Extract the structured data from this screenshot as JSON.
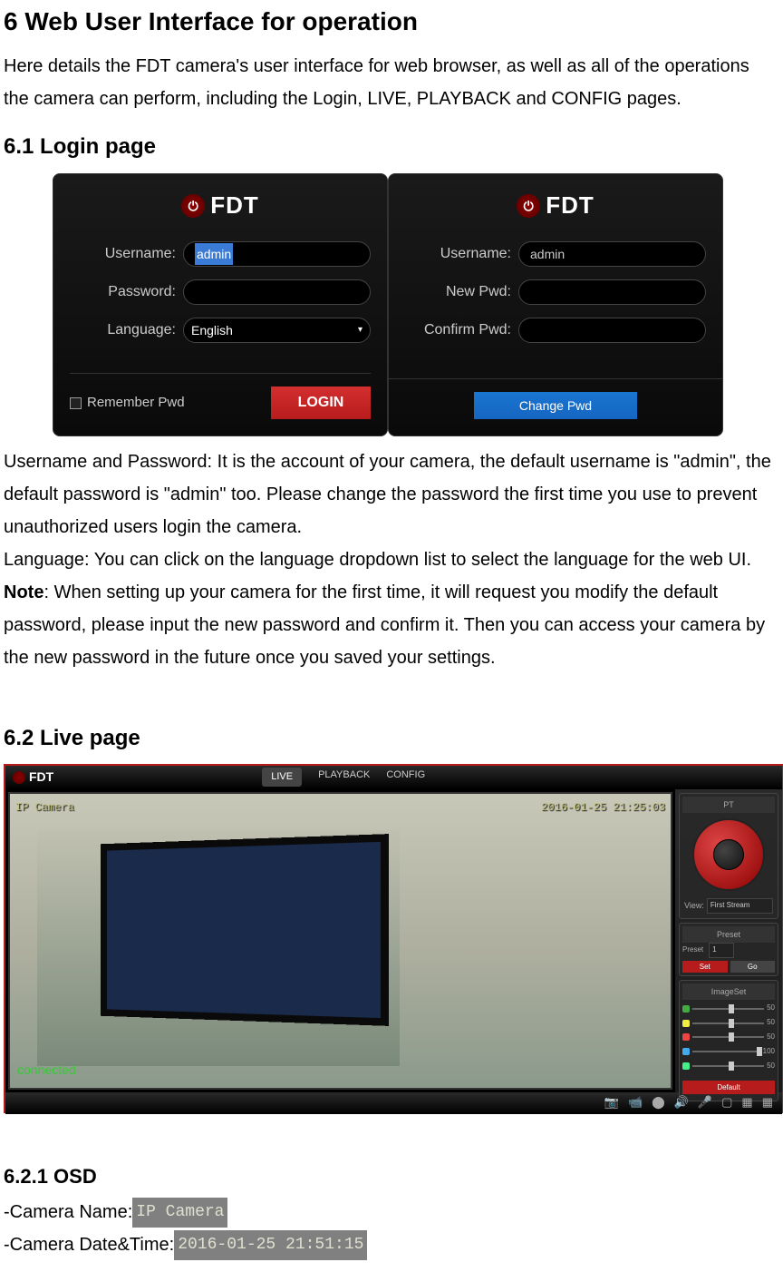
{
  "heading1": "6 Web User Interface for operation",
  "intro_text": "Here details the FDT camera's user interface for web browser, as well as all of the operations the camera can perform, including the Login, LIVE, PLAYBACK and CONFIG pages.",
  "heading2": "6.1 Login page",
  "login_panel": {
    "logo_text": "FDT",
    "logo_icon": "⏻",
    "username_label": "Username:",
    "username_value": "admin",
    "password_label": "Password:",
    "password_value": "",
    "language_label": "Language:",
    "language_value": "English",
    "remember_label": "Remember Pwd",
    "login_btn": "LOGIN"
  },
  "change_panel": {
    "logo_text": "FDT",
    "logo_icon": "⏻",
    "username_label": "Username:",
    "username_value": "admin",
    "newpwd_label": "New Pwd:",
    "newpwd_value": "",
    "confirm_label": "Confirm Pwd:",
    "confirm_value": "",
    "change_btn": "Change Pwd"
  },
  "p1": "Username and Password: It is the account of your camera, the default username is \"admin\", the default password is \"admin\" too. Please change the password the first time you use to prevent unauthorized users login the camera.",
  "p2": "Language: You can click on the language dropdown list to select the language for the web UI.",
  "note_label": "Note",
  "note_text": ": When setting up your camera for the first time, it will request you modify the default password, please input the new password and confirm it. Then you can access your camera by the new password in the future once you saved your settings.",
  "heading3": "6.2 Live page",
  "live_page": {
    "logo_text": "FDT",
    "tabs": [
      "LIVE",
      "PLAYBACK",
      "CONFIG"
    ],
    "osd_name": "IP Camera",
    "osd_time": "2016-01-25 21:25:03",
    "connected": "connected",
    "pt_label": "PT",
    "view_label": "View:",
    "view_value": "First Stream",
    "preset_label": "Preset",
    "preset_row_label": "Preset",
    "preset_value": "1",
    "set_btn": "Set",
    "go_btn": "Go",
    "imageset_label": "ImageSet",
    "default_btn": "Default",
    "sliders": [
      {
        "color": "#4a4",
        "value": "50"
      },
      {
        "color": "#ee4",
        "value": "50"
      },
      {
        "color": "#e44",
        "value": "50"
      },
      {
        "color": "#4ae",
        "value": "100"
      },
      {
        "color": "#4e8",
        "value": "50"
      }
    ]
  },
  "heading4": "6.2.1 OSD",
  "osd_line1_label": "-Camera Name:",
  "osd_line1_value": "IP Camera",
  "osd_line2_label": "-Camera Date&Time:",
  "osd_line2_value": "2016-01-25 21:51:15"
}
